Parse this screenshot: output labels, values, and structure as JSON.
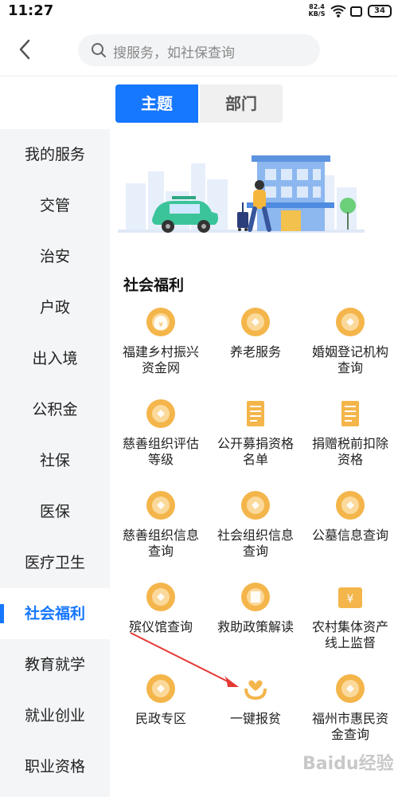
{
  "status_bar": {
    "time": "11:27",
    "net_speed_value": "82.4",
    "net_speed_unit": "KB/S",
    "battery": "34"
  },
  "search": {
    "placeholder": "搜服务，如社保查询"
  },
  "tabs": [
    {
      "label": "主题",
      "active": true
    },
    {
      "label": "部门",
      "active": false
    }
  ],
  "sidebar": {
    "items": [
      {
        "label": "我的服务"
      },
      {
        "label": "交管"
      },
      {
        "label": "治安"
      },
      {
        "label": "户政"
      },
      {
        "label": "出入境"
      },
      {
        "label": "公积金"
      },
      {
        "label": "社保"
      },
      {
        "label": "医保"
      },
      {
        "label": "医疗卫生"
      },
      {
        "label": "社会福利",
        "active": true
      },
      {
        "label": "教育就学"
      },
      {
        "label": "就业创业"
      },
      {
        "label": "职业资格"
      }
    ]
  },
  "section": {
    "title": "社会福利",
    "services": [
      {
        "label": "福建乡村振兴资金网",
        "icon": "money-bag-icon"
      },
      {
        "label": "养老服务",
        "icon": "elderly-icon"
      },
      {
        "label": "婚姻登记机构查询",
        "icon": "marriage-search-icon"
      },
      {
        "label": "慈善组织评估等级",
        "icon": "charity-search-icon"
      },
      {
        "label": "公开募捐资格名单",
        "icon": "document-list-icon"
      },
      {
        "label": "捐赠税前扣除资格",
        "icon": "tax-document-icon"
      },
      {
        "label": "慈善组织信息查询",
        "icon": "charity-info-icon"
      },
      {
        "label": "社会组织信息查询",
        "icon": "organization-icon"
      },
      {
        "label": "公墓信息查询",
        "icon": "cemetery-icon"
      },
      {
        "label": "殡仪馆查询",
        "icon": "funeral-home-icon"
      },
      {
        "label": "救助政策解读",
        "icon": "policy-book-icon"
      },
      {
        "label": "农村集体资产线上监督",
        "icon": "rural-asset-icon"
      },
      {
        "label": "民政专区",
        "icon": "civil-affairs-icon"
      },
      {
        "label": "一键报贫",
        "icon": "helping-hands-icon"
      },
      {
        "label": "福州市惠民资金查询",
        "icon": "fund-search-icon"
      }
    ]
  },
  "colors": {
    "accent": "#1677ff",
    "icon_orange": "#f4b54a",
    "sidebar_bg": "#f4f5f7",
    "annotation_red": "#e53935"
  },
  "watermark": "Baidu经验"
}
